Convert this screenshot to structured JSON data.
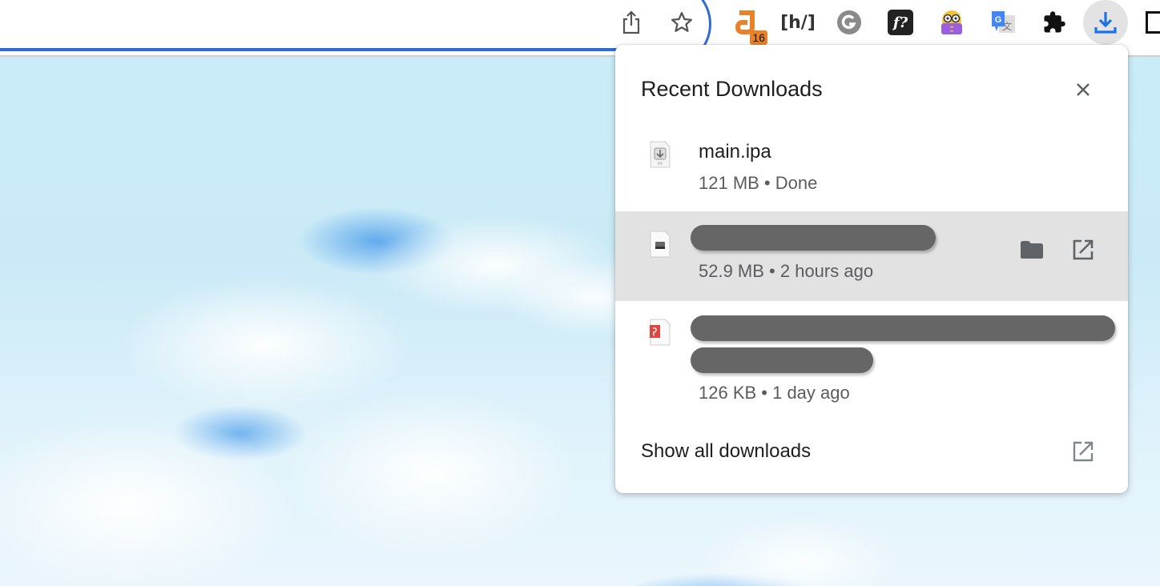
{
  "toolbar": {
    "icons": [
      {
        "name": "share-icon"
      },
      {
        "name": "bookmark-star-icon"
      },
      {
        "name": "extension-a-icon",
        "badge": "16"
      },
      {
        "name": "extension-hypothesis-icon",
        "label": "[h/]"
      },
      {
        "name": "extension-grammarly-icon",
        "label": "G"
      },
      {
        "name": "extension-formula-icon",
        "label": "f?"
      },
      {
        "name": "extension-minion-reader-icon"
      },
      {
        "name": "extension-google-translate-icon",
        "label": "G"
      },
      {
        "name": "extensions-puzzle-icon"
      },
      {
        "name": "downloads-icon"
      }
    ],
    "accent_color": "#2f6bd0"
  },
  "downloads_bubble": {
    "title": "Recent Downloads",
    "close_label": "Close",
    "items": [
      {
        "name": "main.ipa",
        "size": "121 MB",
        "status": "Done",
        "meta": "121 MB • Done",
        "redacted": false,
        "icon": "ipa-file-icon"
      },
      {
        "name": "",
        "size": "52.9 MB",
        "status": "2 hours ago",
        "meta": "52.9 MB • 2 hours ago",
        "redacted": true,
        "icon": "disk-image-file-icon",
        "actions": [
          "show-in-folder",
          "open"
        ]
      },
      {
        "name": "",
        "size": "126 KB",
        "status": "1 day ago",
        "meta": "126 KB • 1 day ago",
        "redacted": true,
        "icon": "pdf-file-icon"
      }
    ],
    "footer_label": "Show all downloads"
  }
}
